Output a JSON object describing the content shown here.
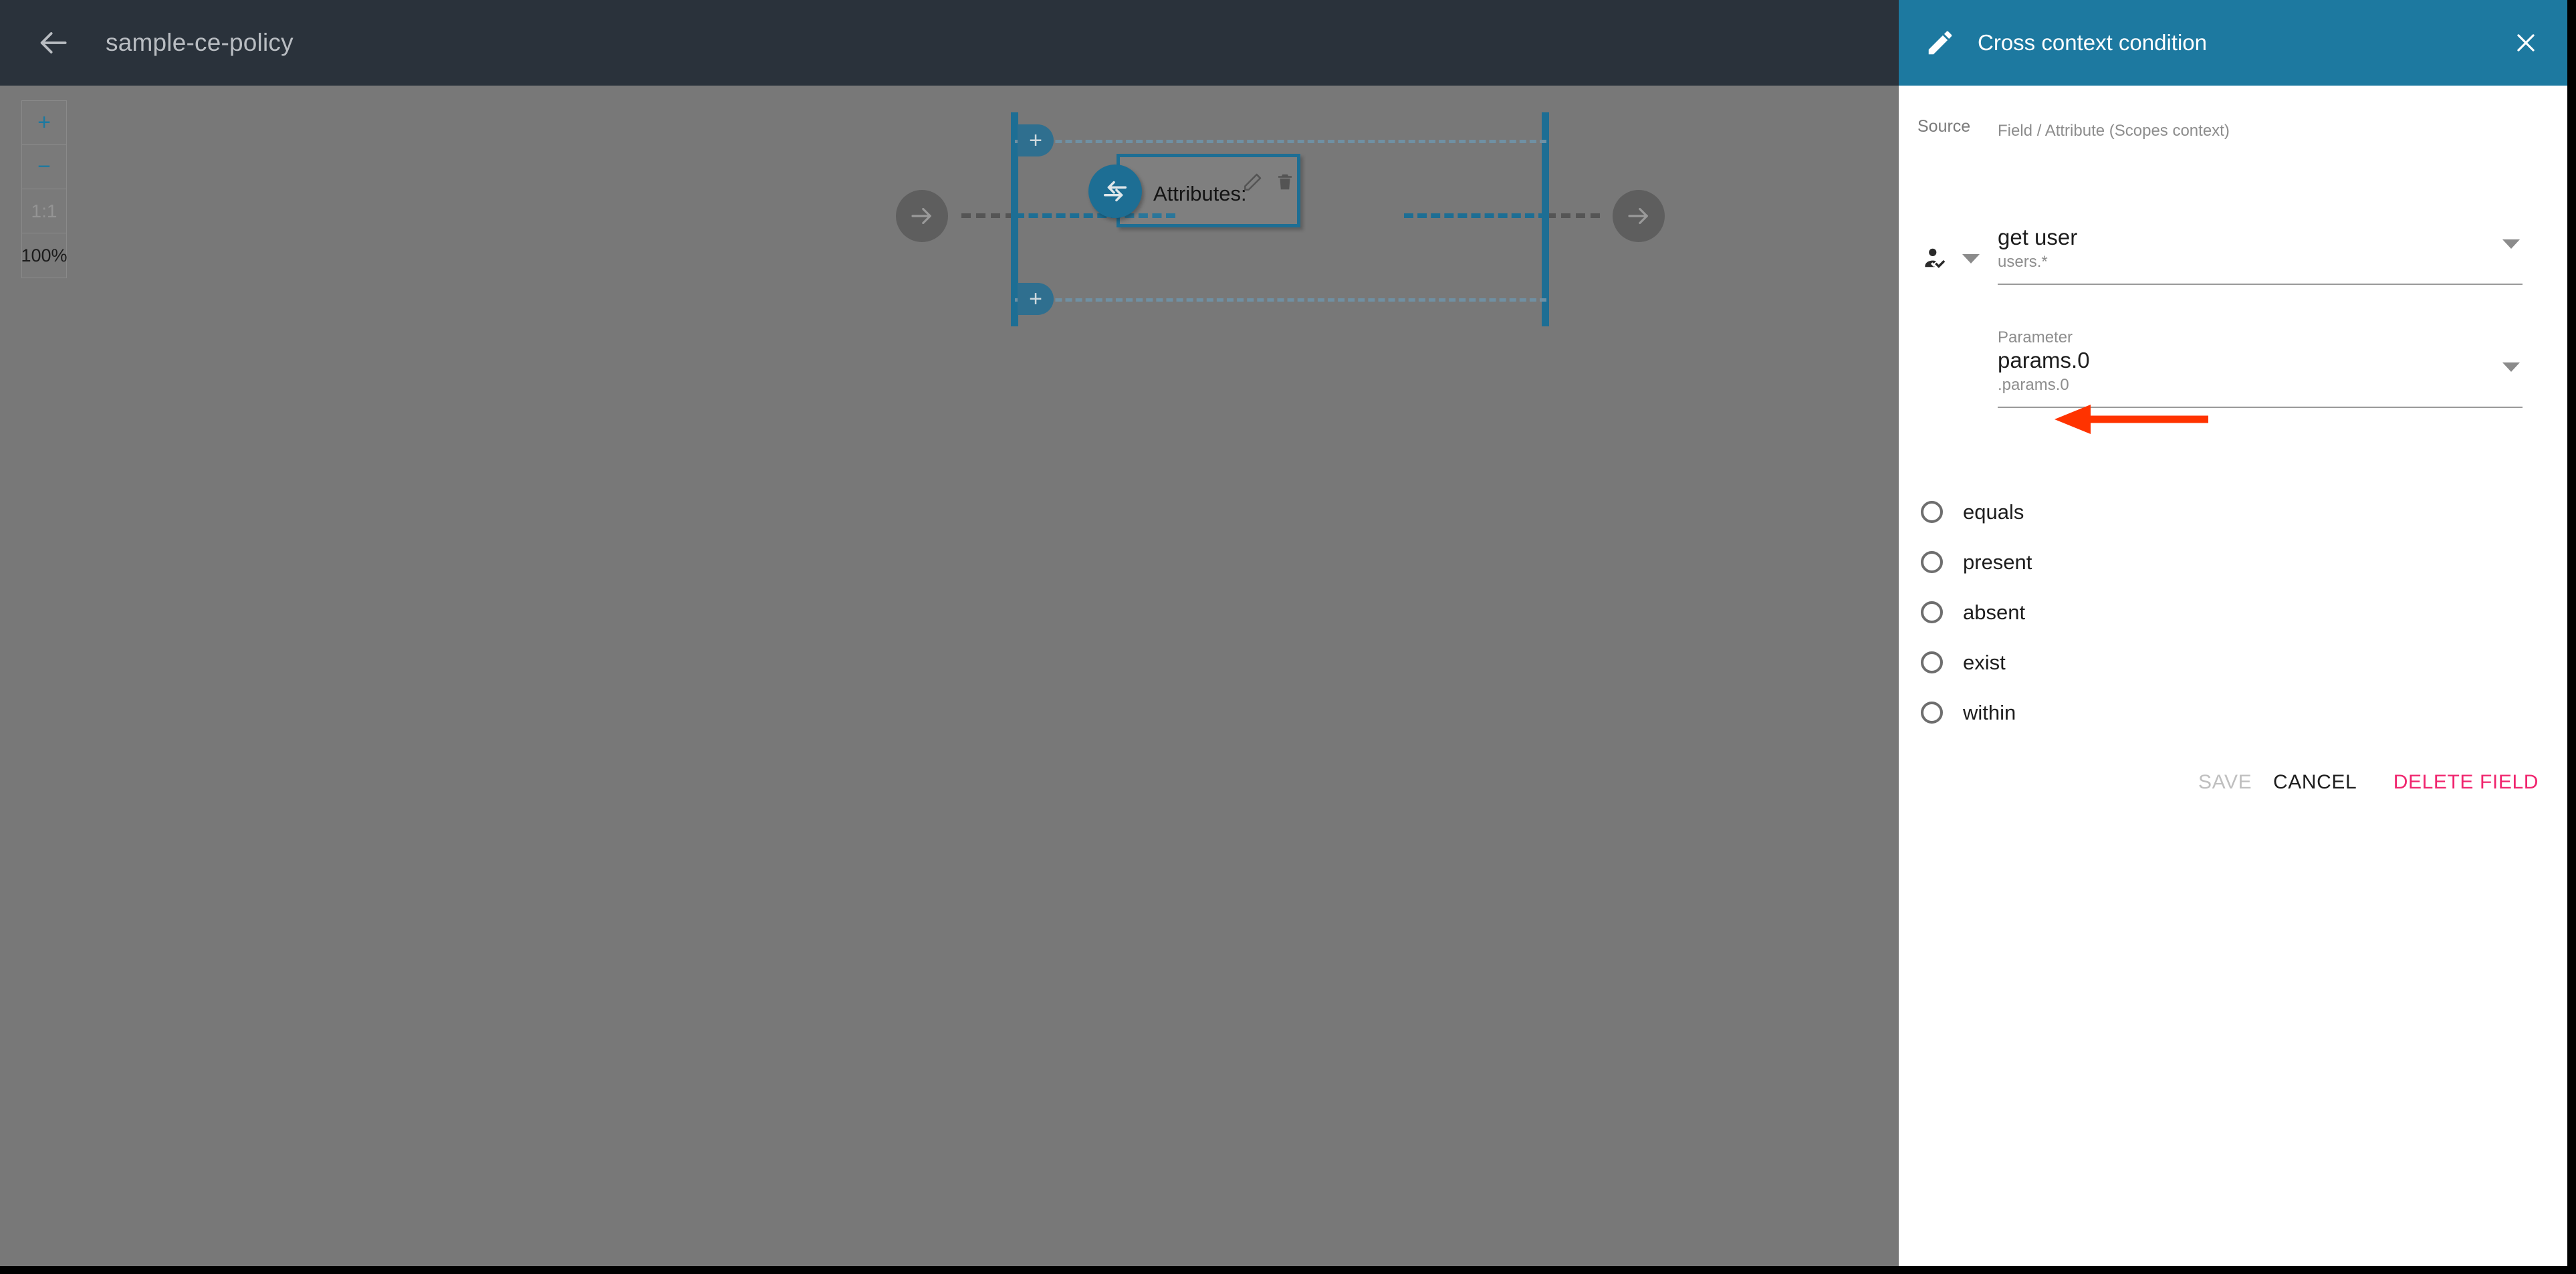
{
  "topbar": {
    "back_icon": "arrow-left-icon",
    "title": "sample-ce-policy"
  },
  "canvas": {
    "zoom_controls": {
      "zoom_in_label": "+",
      "zoom_out_label": "−",
      "fit_label": "1:1",
      "zoom_level_label": "100%"
    },
    "diagram": {
      "start_node_icon": "arrow-right-icon",
      "end_node_icon": "arrow-right-icon",
      "swap_node_icon": "swap-horizontal-icon",
      "add_top_label": "+",
      "add_bottom_label": "+",
      "attributes_label": "Attributes:",
      "edit_icon": "pencil-icon",
      "delete_icon": "trash-icon",
      "accent_color": "#1d6e94",
      "background_color": "#787878"
    }
  },
  "panel": {
    "header": {
      "icon": "pencil-icon",
      "title": "Cross context condition",
      "close_icon": "close-icon",
      "background_color": "#1d79a0"
    },
    "source": {
      "label": "Source",
      "icon": "person-check-icon",
      "caret_icon": "chevron-down-icon"
    },
    "field": {
      "caption": "Field / Attribute (Scopes context)",
      "value": "get user",
      "sub_value": "users.*",
      "caret_icon": "chevron-down-icon"
    },
    "parameter": {
      "caption": "Parameter",
      "value": "params.0",
      "sub_value": ".params.0",
      "caret_icon": "chevron-down-icon"
    },
    "operators": [
      {
        "label": "equals",
        "selected": false
      },
      {
        "label": "present",
        "selected": false
      },
      {
        "label": "absent",
        "selected": false
      },
      {
        "label": "exist",
        "selected": false
      },
      {
        "label": "within",
        "selected": false
      }
    ],
    "actions": {
      "save_label": "SAVE",
      "cancel_label": "CANCEL",
      "delete_label": "DELETE FIELD",
      "delete_color": "#f0256e",
      "save_disabled": true
    }
  },
  "annotation": {
    "arrow_color": "#ff3300",
    "points_to": "equals"
  }
}
